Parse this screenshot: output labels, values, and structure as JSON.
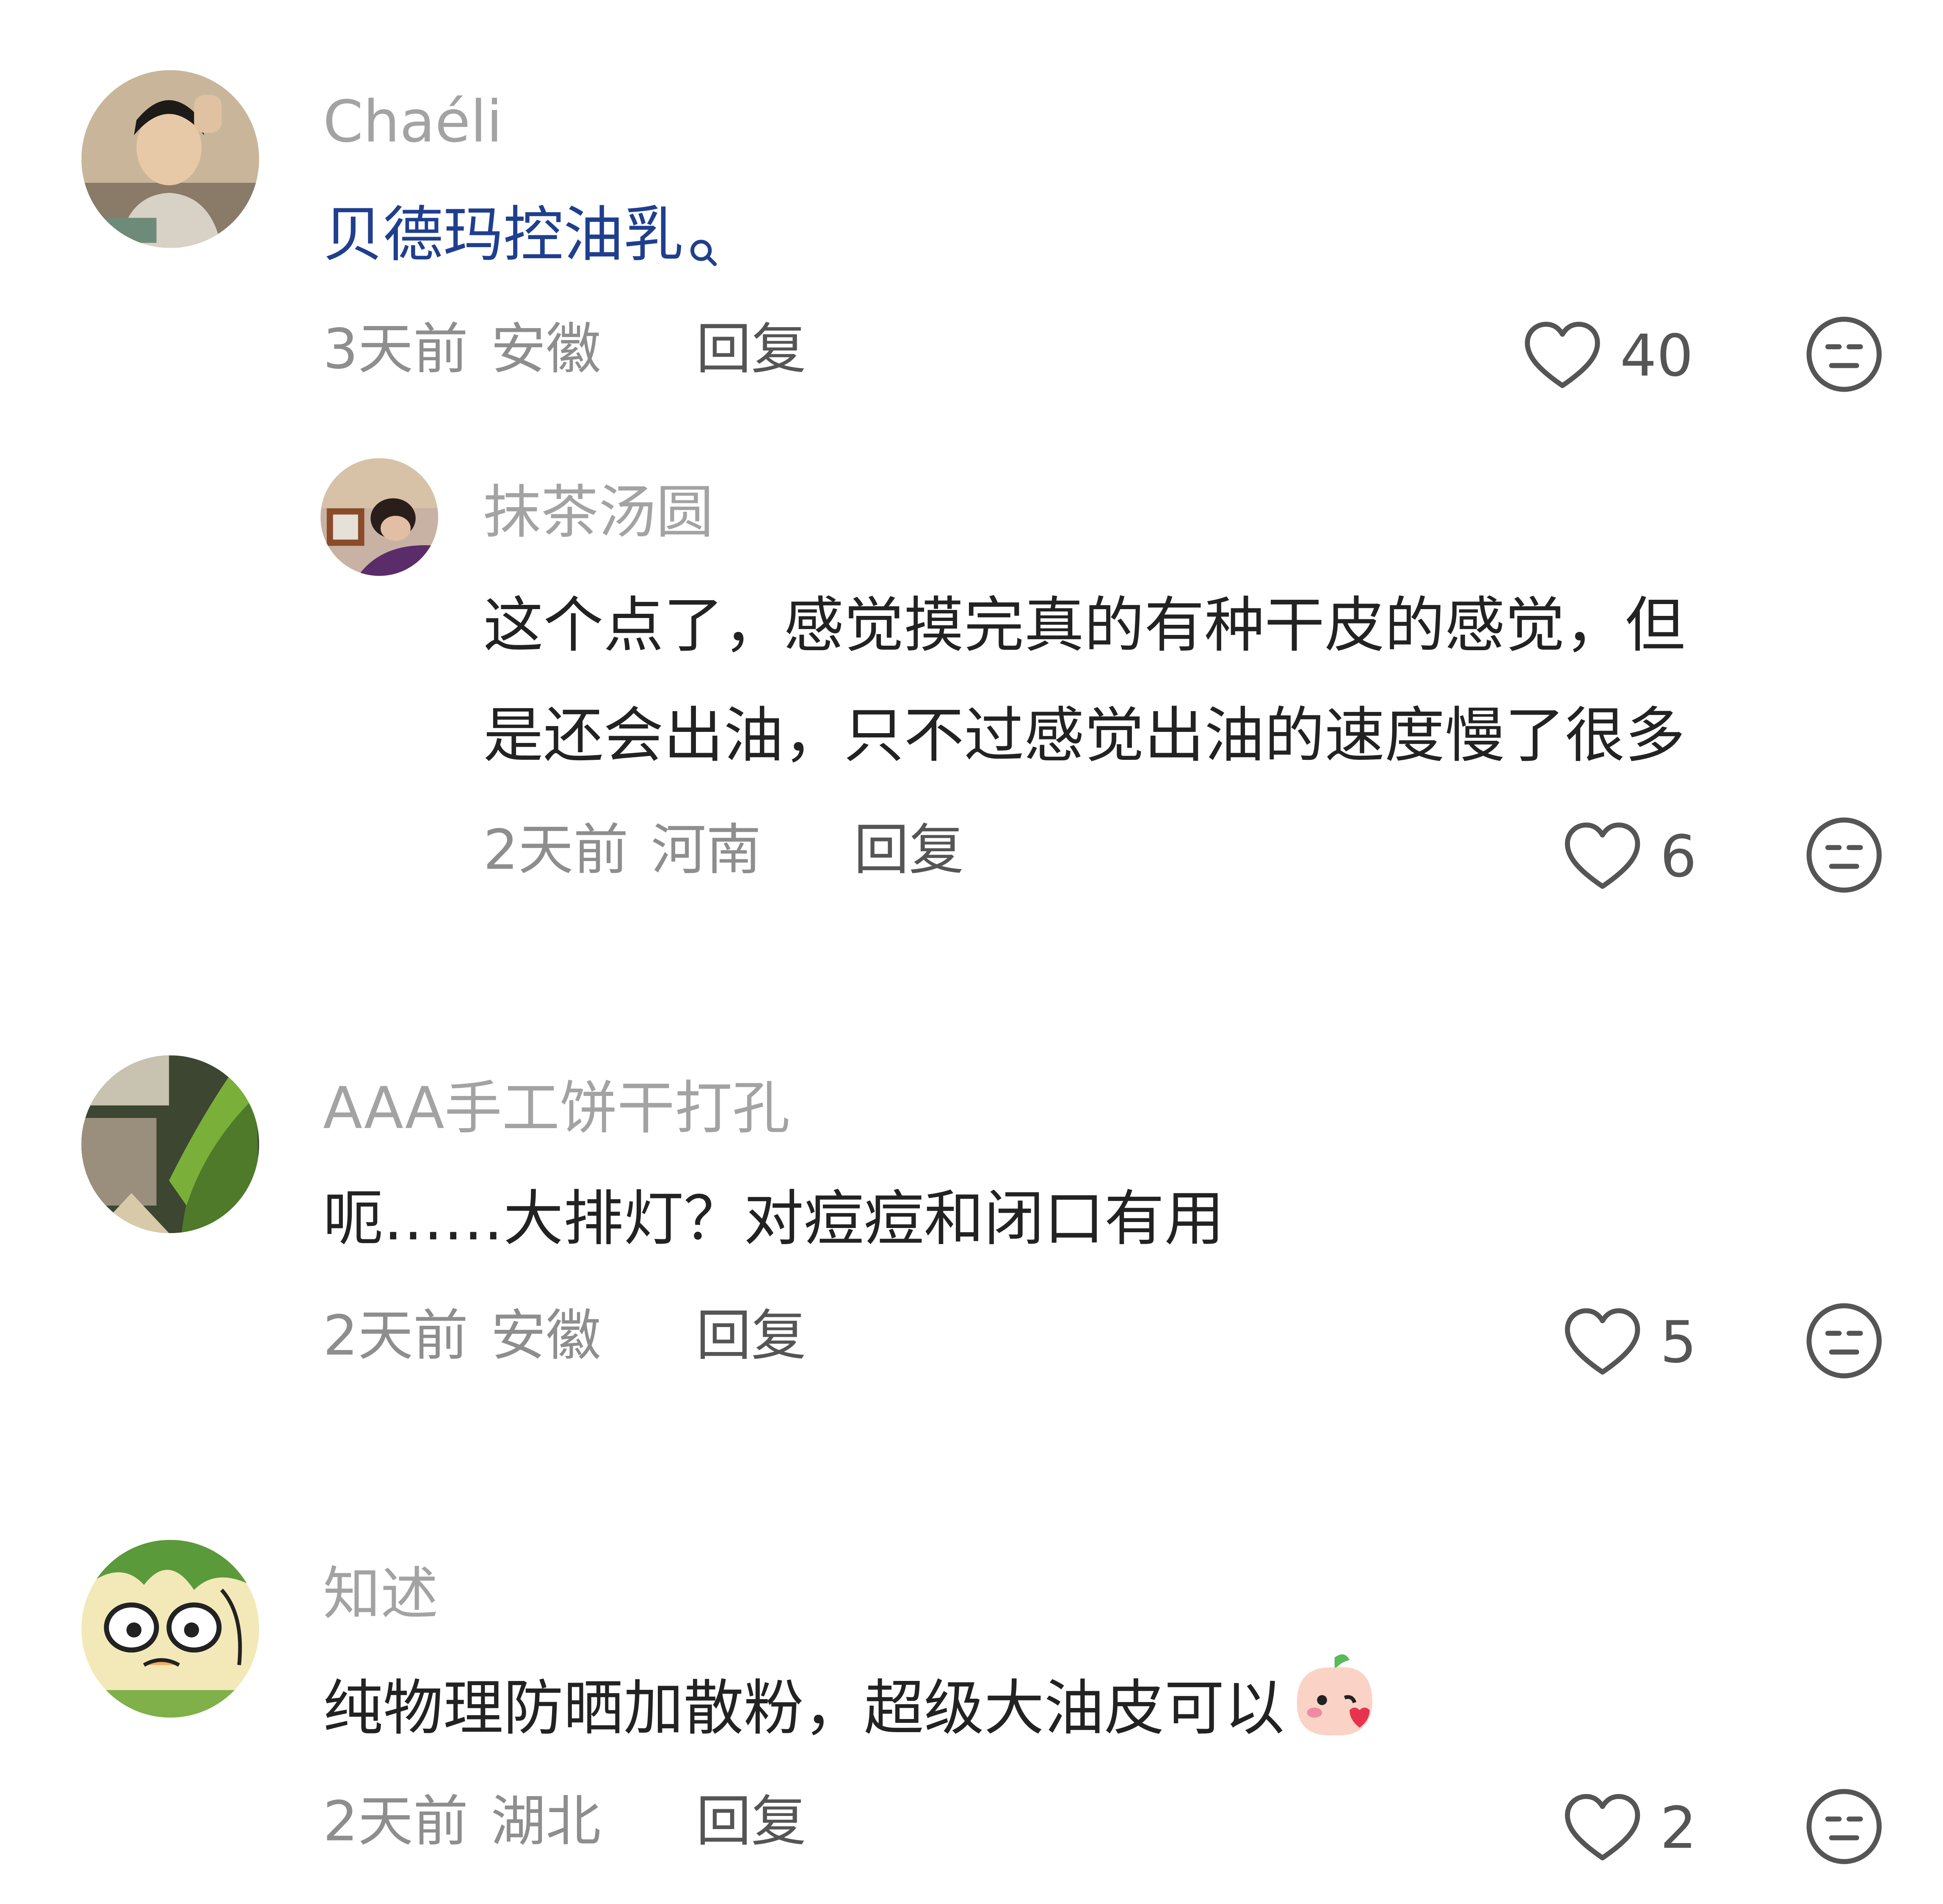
{
  "comments": [
    {
      "username": "Chaéli",
      "text": "贝德玛控油乳",
      "text_is_search_link": true,
      "time": "3天前",
      "location": "安徽",
      "reply_label": "回复",
      "likes": "40",
      "avatar": "portrait-photo",
      "replies": [
        {
          "username": "抹茶汤圆",
          "text_lines": [
            "这个点了，感觉摸完真的有种干皮的感觉，但",
            "是还会出油，只不过感觉出油的速度慢了很多"
          ],
          "time": "2天前",
          "location": "河南",
          "reply_label": "回复",
          "likes": "6",
          "avatar": "person-lying-photo"
        }
      ]
    },
    {
      "username": "AAA手工饼干打孔",
      "text": "呃……大排灯？对痘痘和闭口有用",
      "time": "2天前",
      "location": "安徽",
      "reply_label": "回复",
      "likes": "5",
      "avatar": "plant-photo"
    },
    {
      "username": "知述",
      "text": "纯物理防晒加散粉，超级大油皮可以",
      "text_emoji": "blushing-peach-emoji",
      "time": "2天前",
      "location": "湖北",
      "reply_label": "回复",
      "likes": "2",
      "avatar": "cartoon-face"
    }
  ],
  "icons": {
    "like": "heart-outline-icon",
    "dislike": "neutral-face-icon"
  },
  "colors": {
    "username": "#a3a3a3",
    "link": "#1f3f8e",
    "body_text": "#222222",
    "meta": "#8e8e8e",
    "icon": "#555555"
  }
}
